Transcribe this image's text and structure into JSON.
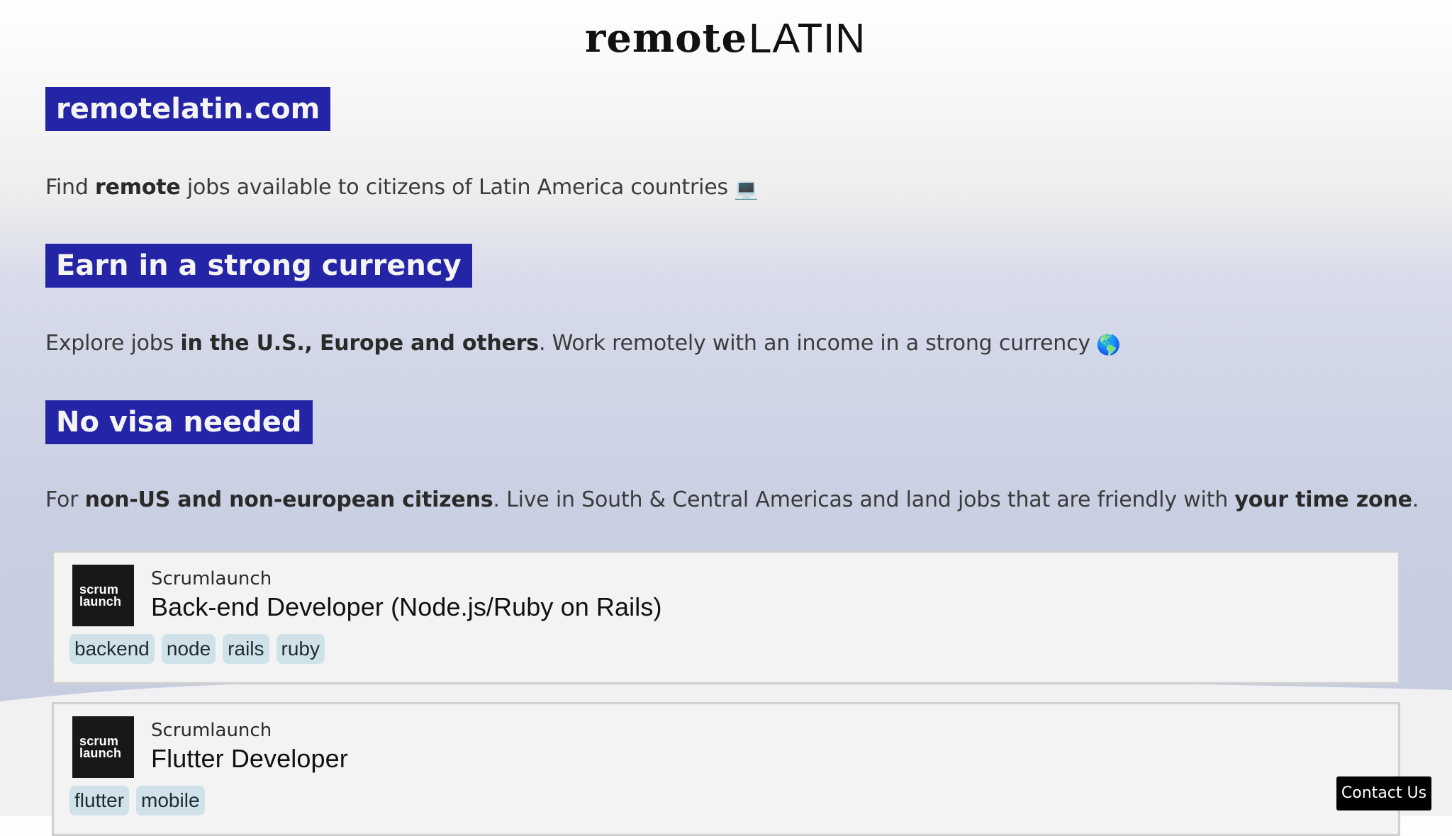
{
  "logo": {
    "part1": "remote",
    "part2": "LATIN"
  },
  "sections": [
    {
      "heading": "remotelatin.com",
      "text": {
        "before": "Find ",
        "bold_1": "remote",
        "after_1": " jobs available to citizens of Latin America countries",
        "emoji": "💻"
      }
    },
    {
      "heading": "Earn in a strong currency",
      "text": {
        "before": "Explore jobs ",
        "bold_1": "in the U.S., Europe and others",
        "after_1": ". Work remotely with an income in a strong currency",
        "emoji": "🌎"
      }
    },
    {
      "heading": "No visa needed",
      "text": {
        "before": "For ",
        "bold_1": "non-US and non-european citizens",
        "after_1": ". Live in South & Central Americas and land jobs that are friendly with ",
        "bold_2": "your time zone",
        "after_2": "."
      }
    }
  ],
  "jobs": [
    {
      "company": "Scrumlaunch",
      "logo_line_1": "scrum",
      "logo_line_2": "launch",
      "title": "Back-end Developer (Node.js/Ruby on Rails)",
      "tags": [
        "backend",
        "node",
        "rails",
        "ruby"
      ]
    },
    {
      "company": "Scrumlaunch",
      "logo_line_1": "scrum",
      "logo_line_2": "launch",
      "title": "Flutter Developer",
      "tags": [
        "flutter",
        "mobile"
      ]
    }
  ],
  "footer": {
    "contact_label": "Contact Us"
  },
  "colors": {
    "heading_background": "#2424a7",
    "tag_background": "#cfe2ea",
    "card_background": "#f3f3f3",
    "contact_background": "#000000"
  }
}
